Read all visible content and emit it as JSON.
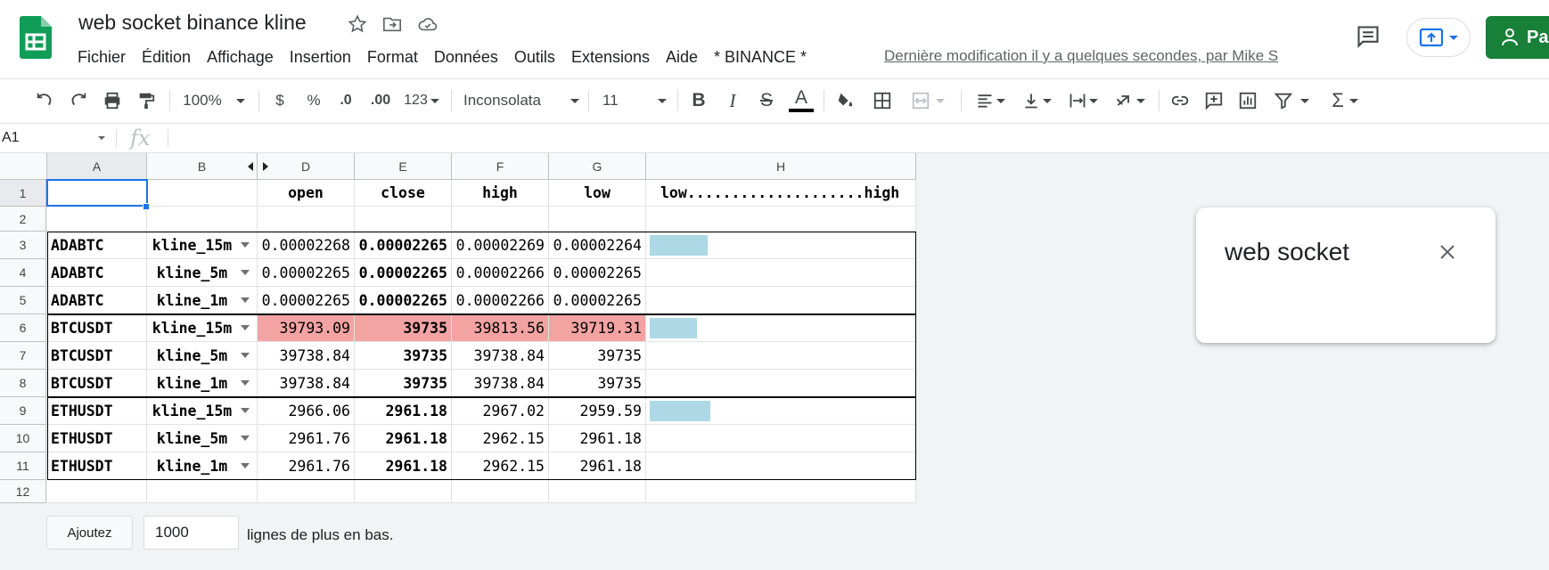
{
  "doc": {
    "title": "web socket binance kline",
    "last_edit": "Dernière modification il y a quelques secondes, par Mike S",
    "share_label": "Par"
  },
  "menu": [
    "Fichier",
    "Édition",
    "Affichage",
    "Insertion",
    "Format",
    "Données",
    "Outils",
    "Extensions",
    "Aide",
    "* BINANCE *"
  ],
  "toolbar": {
    "zoom": "100%",
    "currency": "$",
    "percent": "%",
    "dec_minus": ".0",
    "dec_plus": ".00",
    "number_format": "123",
    "font": "Inconsolata",
    "font_size": "11"
  },
  "formula": {
    "namebox": "A1",
    "fx": "fx",
    "value": ""
  },
  "columns": [
    "A",
    "B",
    "D",
    "E",
    "F",
    "G",
    "H"
  ],
  "rows": [
    {
      "n": "1",
      "a": "",
      "b": "",
      "d": "open",
      "e": "close",
      "f": "high",
      "g": "low",
      "h": "low....................high"
    },
    {
      "n": "2",
      "a": "",
      "b": "",
      "d": "",
      "e": "",
      "f": "",
      "g": "",
      "h": ""
    },
    {
      "n": "3",
      "a": "ADABTC",
      "b": "kline_15m",
      "d": "0.00002268",
      "e": "0.00002265",
      "f": "0.00002269",
      "g": "0.00002264",
      "h": ""
    },
    {
      "n": "4",
      "a": "ADABTC",
      "b": "kline_5m",
      "d": "0.00002265",
      "e": "0.00002265",
      "f": "0.00002266",
      "g": "0.00002265",
      "h": ""
    },
    {
      "n": "5",
      "a": "ADABTC",
      "b": "kline_1m",
      "d": "0.00002265",
      "e": "0.00002265",
      "f": "0.00002266",
      "g": "0.00002265",
      "h": ""
    },
    {
      "n": "6",
      "a": "BTCUSDT",
      "b": "kline_15m",
      "d": "39793.09",
      "e": "39735",
      "f": "39813.56",
      "g": "39719.31",
      "h": ""
    },
    {
      "n": "7",
      "a": "BTCUSDT",
      "b": "kline_5m",
      "d": "39738.84",
      "e": "39735",
      "f": "39738.84",
      "g": "39735",
      "h": ""
    },
    {
      "n": "8",
      "a": "BTCUSDT",
      "b": "kline_1m",
      "d": "39738.84",
      "e": "39735",
      "f": "39738.84",
      "g": "39735",
      "h": ""
    },
    {
      "n": "9",
      "a": "ETHUSDT",
      "b": "kline_15m",
      "d": "2966.06",
      "e": "2961.18",
      "f": "2967.02",
      "g": "2959.59",
      "h": ""
    },
    {
      "n": "10",
      "a": "ETHUSDT",
      "b": "kline_5m",
      "d": "2961.76",
      "e": "2961.18",
      "f": "2962.15",
      "g": "2961.18",
      "h": ""
    },
    {
      "n": "11",
      "a": "ETHUSDT",
      "b": "kline_1m",
      "d": "2961.76",
      "e": "2961.18",
      "f": "2962.15",
      "g": "2961.18",
      "h": ""
    },
    {
      "n": "12",
      "a": "",
      "b": "",
      "d": "",
      "e": "",
      "f": "",
      "g": "",
      "h": ""
    }
  ],
  "sparklines": [
    {
      "row": "3",
      "fraction": 0.22
    },
    {
      "row": "6",
      "fraction": 0.18
    },
    {
      "row": "9",
      "fraction": 0.23
    }
  ],
  "highlight_color": "#f4a3a3",
  "sparkline_color": "#add8e6",
  "add_rows": {
    "button": "Ajoutez",
    "count": "1000",
    "label": "lignes de plus en bas."
  },
  "popup": {
    "title": "web socket"
  }
}
